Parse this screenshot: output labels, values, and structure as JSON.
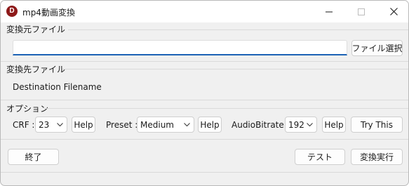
{
  "window": {
    "title": "mp4動画変換",
    "app_icon_letter": "D"
  },
  "source": {
    "group_label": "変換元ファイル",
    "path_value": "",
    "browse_label": "ファイル選択"
  },
  "destination": {
    "group_label": "変換先ファイル",
    "filename": "Destination Filename"
  },
  "options": {
    "group_label": "オプション",
    "crf_label": "CRF :",
    "crf_value": "23",
    "crf_help_label": "Help",
    "preset_label": "Preset :",
    "preset_value": "Medium",
    "preset_help_label": "Help",
    "audio_label": "AudioBitrate :",
    "audio_value": "192",
    "audio_help_label": "Help",
    "try_label": "Try This"
  },
  "footer": {
    "quit_label": "終了",
    "test_label": "テスト",
    "run_label": "変換実行"
  },
  "colors": {
    "accent": "#1c63b5",
    "app_icon": "#8e1a1a"
  }
}
